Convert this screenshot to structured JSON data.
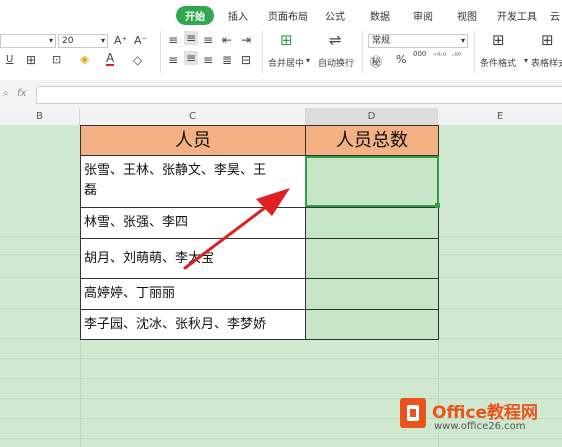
{
  "ribbon": {
    "tabs": [
      "开始",
      "插入",
      "页面布局",
      "公式",
      "数据",
      "审阅",
      "视图",
      "开发工具",
      "云"
    ],
    "font_size": "20",
    "font_grow": "A⁺",
    "font_shrink": "A⁻",
    "merge_label": "合并居中",
    "wrap_label": "自动换行",
    "number_format": "常规",
    "percent": "%",
    "thousands": "000",
    "conditional_format": "条件格式",
    "table_style": "表格样式"
  },
  "formula_bar": {
    "fx": "fx",
    "value": ""
  },
  "columns": [
    "B",
    "C",
    "D",
    "E"
  ],
  "table": {
    "headers": [
      "人员",
      "人员总数"
    ],
    "rows": [
      {
        "people_line1": "张雪、王林、张静文、李昊、王",
        "people_line2": "磊",
        "count": ""
      },
      {
        "people_line1": "林雪、张强、李四",
        "count": ""
      },
      {
        "people_line1": "胡月、刘萌萌、李大宝",
        "count": ""
      },
      {
        "people_line1": "高婷婷、丁丽丽",
        "count": ""
      },
      {
        "people_line1": "李子园、沈冰、张秋月、李梦娇",
        "count": ""
      }
    ]
  },
  "watermark": {
    "brand": "Office教程网",
    "url": "www.office26.com"
  },
  "colors": {
    "header_fill": "#f4b183",
    "sheet_bg": "#cfe8cf",
    "selection": "#2f9e44",
    "arrow": "#e02020",
    "active_tab": "#2fa84f"
  }
}
